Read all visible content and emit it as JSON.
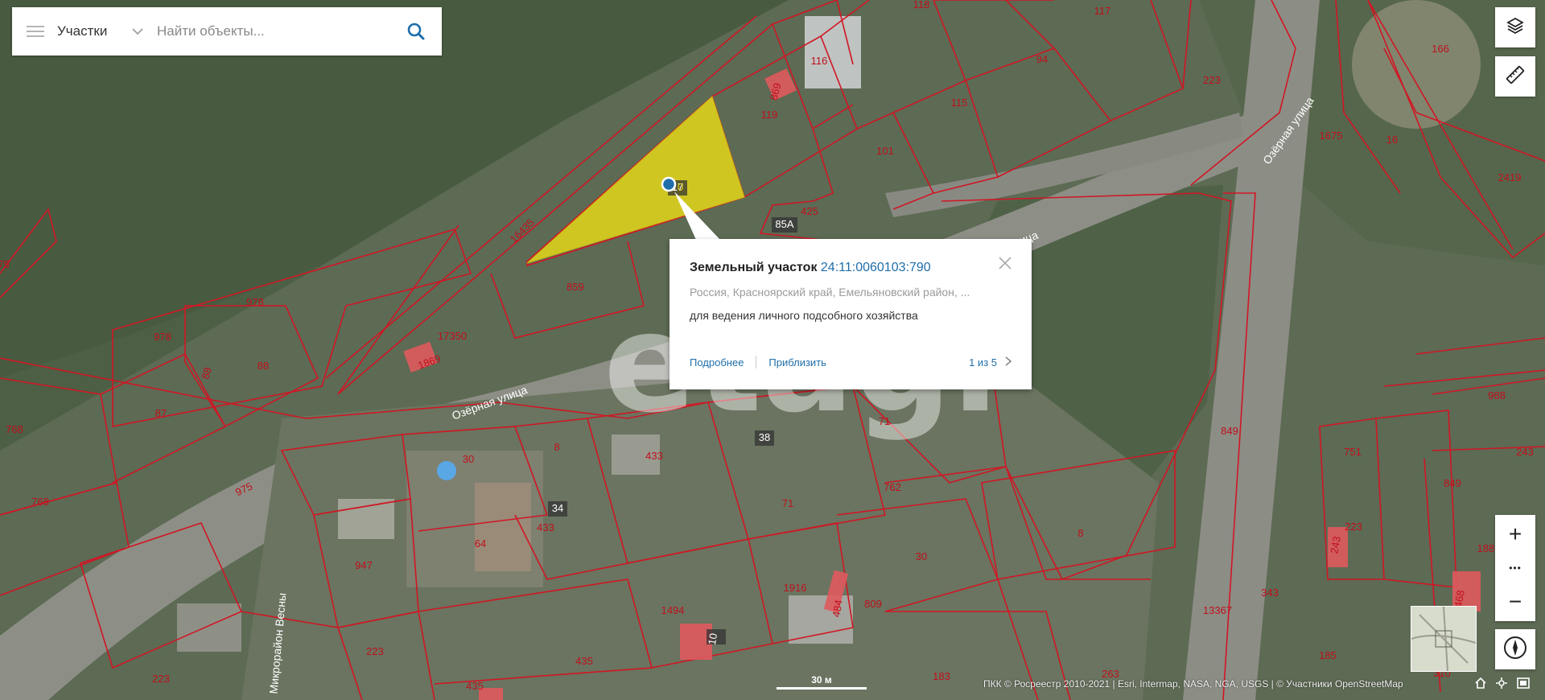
{
  "search": {
    "category": "Участки",
    "placeholder": "Найти объекты..."
  },
  "popup": {
    "title": "Земельный участок",
    "cadastral_number": "24:11:0060103:790",
    "address": "Россия, Красноярский край, Емельяновский район, ...",
    "usage": "для ведения личного подсобного хозяйства",
    "details_link": "Подробнее",
    "zoom_link": "Приблизить",
    "pager": "1 из 5"
  },
  "map": {
    "parcel_numbers": [
      "118",
      "117",
      "116",
      "869",
      "119",
      "94",
      "115",
      "101",
      "223",
      "166",
      "1675",
      "16",
      "2419",
      "16435",
      "85А",
      "425",
      "859",
      "978",
      "978",
      "17350",
      "1869",
      "88",
      "88",
      "87",
      "768",
      "768",
      "975",
      "30",
      "8",
      "34",
      "433",
      "433",
      "38",
      "71",
      "71",
      "762",
      "762",
      "988",
      "751",
      "243",
      "849",
      "849",
      "223",
      "243",
      "1881",
      "468",
      "947",
      "64",
      "30",
      "8",
      "1916",
      "484",
      "809",
      "1494",
      "10",
      "343",
      "13367",
      "223",
      "223",
      "435",
      "435",
      "185",
      "310",
      "183",
      "263",
      "17",
      "475",
      "0",
      "1"
    ],
    "dark_labels": [
      "85А",
      "34",
      "10",
      "38",
      "17"
    ],
    "streets": [
      "Озёрная улица",
      "Озёрная улица",
      "Микрорайон Весны",
      "ица"
    ],
    "selected_label": "0",
    "watermark": "etagi",
    "scale_label": "30 м",
    "attribution": "ПКК © Росреестр 2010-2021 | Esri, Intermap, NASA, NGA, USGS | © Участники OpenStreetMap",
    "colors": {
      "boundary": "#d11624",
      "selected_fill": "#e4d61a",
      "building": "#e05a5e",
      "link": "#1f6ea9"
    }
  },
  "controls": {
    "layers": "layers-icon",
    "ruler": "ruler-icon",
    "zoom_in": "+",
    "more": "•••",
    "zoom_out": "−",
    "compass": "compass-icon"
  }
}
